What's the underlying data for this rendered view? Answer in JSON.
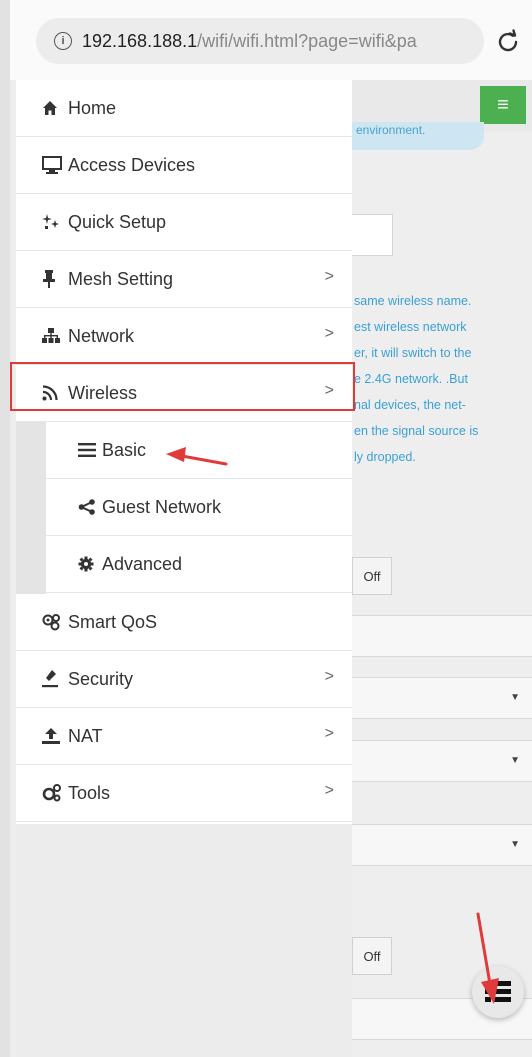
{
  "browser": {
    "url_host": "192.168.188.1",
    "url_path": "/wifi/wifi.html?page=wifi&pa",
    "info_icon": "info-icon",
    "reload_icon": "reload-icon"
  },
  "background_page": {
    "menu_icon": "≡",
    "notice_text": "environment.",
    "info_lines": [
      "same wireless name.",
      "est wireless network",
      "er, it will switch to the",
      "e 2.4G network. .But",
      "nal devices, the net-",
      "en the signal source is",
      "ly dropped."
    ],
    "toggle_off_1": "Off",
    "toggle_off_2": "Off"
  },
  "drawer": {
    "items": [
      {
        "label": "Home",
        "icon": "home-icon",
        "has_chevron": false
      },
      {
        "label": "Access Devices",
        "icon": "monitor-icon",
        "has_chevron": false
      },
      {
        "label": "Quick Setup",
        "icon": "sparkle-icon",
        "has_chevron": false
      },
      {
        "label": "Mesh Setting",
        "icon": "pin-icon",
        "has_chevron": true
      },
      {
        "label": "Network",
        "icon": "sitemap-icon",
        "has_chevron": true
      },
      {
        "label": "Wireless",
        "icon": "rss-icon",
        "has_chevron": true,
        "highlighted": true
      }
    ],
    "subitems": [
      {
        "label": "Basic",
        "icon": "list-icon"
      },
      {
        "label": "Guest Network",
        "icon": "share-icon"
      },
      {
        "label": "Advanced",
        "icon": "gear-icon"
      }
    ],
    "items_after": [
      {
        "label": "Smart QoS",
        "icon": "cogs-icon",
        "has_chevron": false
      },
      {
        "label": "Security",
        "icon": "security-icon",
        "has_chevron": true
      },
      {
        "label": "NAT",
        "icon": "upload-icon",
        "has_chevron": true
      },
      {
        "label": "Tools",
        "icon": "tools-icon",
        "has_chevron": true
      }
    ],
    "chevron": ">"
  },
  "annotation": {
    "highlight_color": "#e03a3a"
  }
}
